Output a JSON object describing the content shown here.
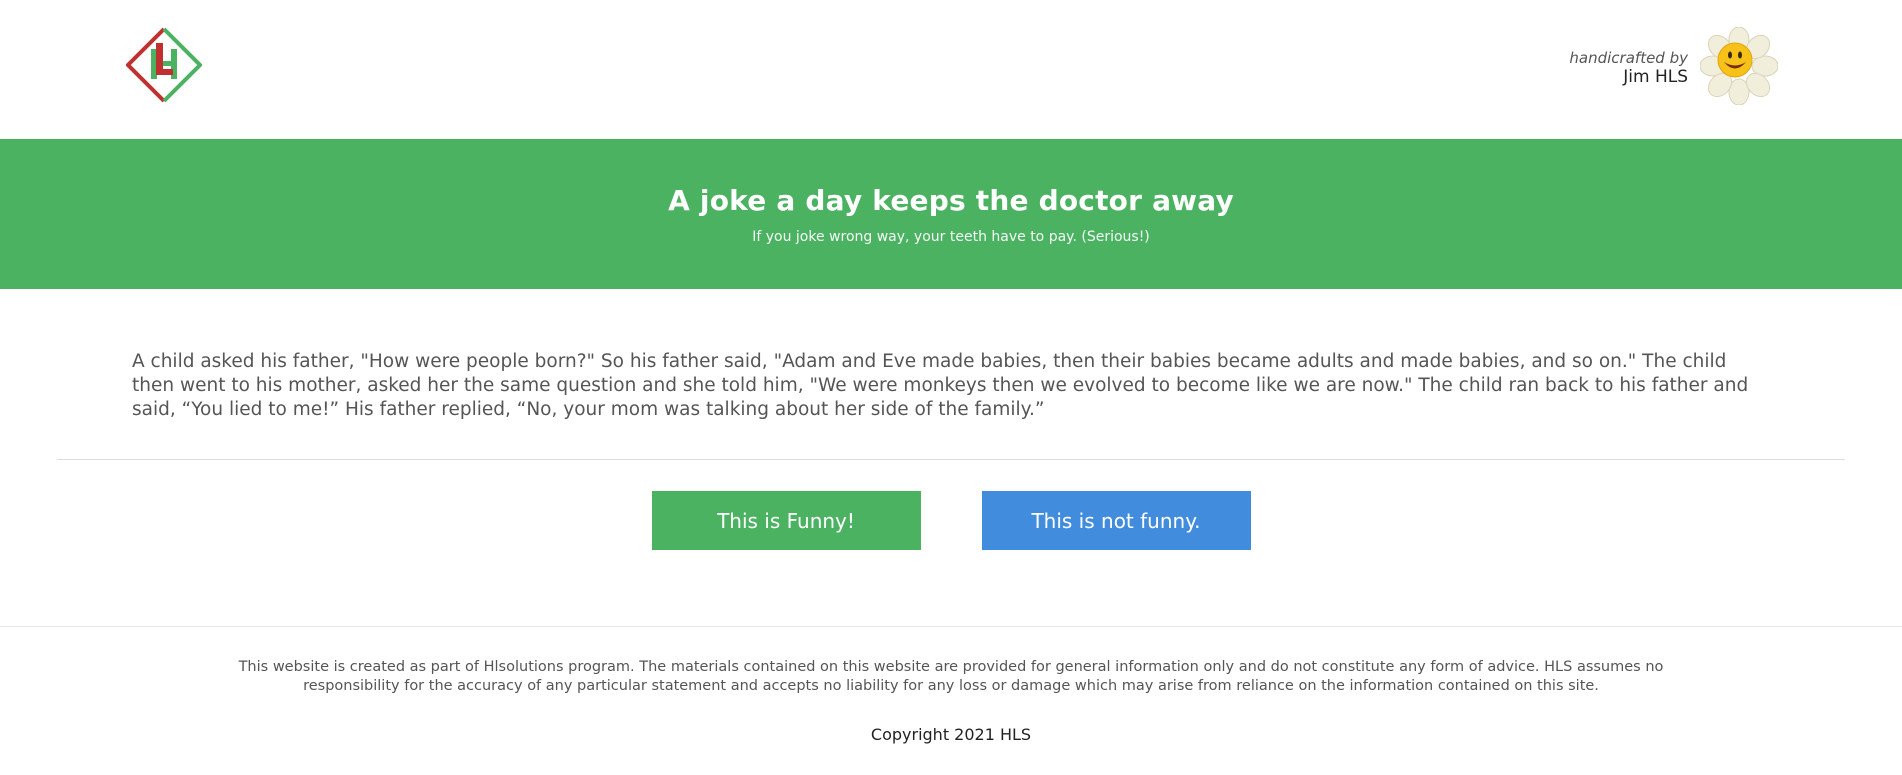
{
  "header": {
    "logo_icon": "hls-diamond-logo-icon",
    "credit_by": "handicrafted by",
    "credit_author": "Jim HLS",
    "avatar_icon": "smiling-daisy-icon"
  },
  "banner": {
    "title": "A joke a day keeps the doctor away",
    "subtitle": "If you joke wrong way, your teeth have to pay. (Serious!)"
  },
  "joke": {
    "text": "A child asked his father, \"How were people born?\" So his father said, \"Adam and Eve made babies, then their babies became adults and made babies, and so on.\" The child then went to his mother, asked her the same question and she told him, \"We were monkeys then we evolved to become like we are now.\" The child ran back to his father and said, “You lied to me!” His father replied, “No, your mom was talking about her side of the family.”"
  },
  "actions": {
    "funny_label": "This is Funny!",
    "not_funny_label": "This is not funny."
  },
  "footer": {
    "disclaimer": "This website is created as part of Hlsolutions program. The materials contained on this website are provided for general information only and do not constitute any form of advice. HLS assumes no responsibility for the accuracy of any particular statement and accepts no liability for any loss or damage which may arise from reliance on the information contained on this site.",
    "copyright": "Copyright 2021 HLS"
  },
  "colors": {
    "brand_green": "#4bb262",
    "button_blue": "#418cdc",
    "logo_red": "#c0302f"
  }
}
